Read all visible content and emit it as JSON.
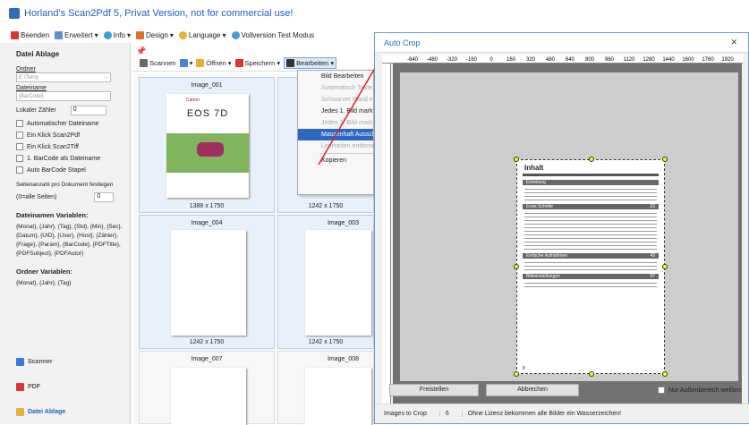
{
  "app": {
    "title": "Horland's Scan2Pdf 5, Privat Version, not for commercial use!"
  },
  "menu": [
    {
      "label": "Beenden",
      "icon": "close-icon"
    },
    {
      "label": "Erweitert",
      "icon": "gear-icon"
    },
    {
      "label": "Info",
      "icon": "info-icon"
    },
    {
      "label": "Design",
      "icon": "palette-icon"
    },
    {
      "label": "Language",
      "icon": "globe-icon"
    },
    {
      "label": "Vollversion Test Modus",
      "icon": "refresh-icon"
    }
  ],
  "sidebar": {
    "header": "Datei Ablage",
    "ordner_label": "Ordner",
    "ordner_value": "E:\\Temp",
    "dateiname_label": "Dateiname",
    "dateiname_value": "{BarCode}",
    "zaehler_label": "Lokaler Zähler",
    "zaehler_value": "0",
    "checks": [
      "Automatischer Dateiname",
      "Ein Klick Scan2Pdf",
      "Ein Klick Scan2Tiff",
      "1. BarCode als Dateiname",
      "Auto BarCode Stapel"
    ],
    "seiten_label": "Seitenanzahl pro Dokument festlegen",
    "alle_label": "(0=alle Seiten)",
    "alle_value": "0",
    "vars_title": "Dateinamen Variablen:",
    "vars_text": "{Monat}, {Jahr}, {Tag}, {Std}, {Min}, {Sec}, {Datum}, {UID}, {User}, {Host}, {Zähler}, {Frage}, {Param}, {BarCode}, {PDFTitle}, {PDFSubject}, {PDFAutor}",
    "ordner_vars_title": "Ordner Variablen:",
    "ordner_vars_text": "{Monat}, {Jahr}, {Tag}",
    "nav": [
      "Scanner",
      "PDF",
      "Datei Ablage"
    ]
  },
  "toolbar": {
    "scannen": "Scannen",
    "oeffnen": "Öffnen",
    "speichern": "Speichern",
    "bearbeiten": "Bearbeiten"
  },
  "thumbs": [
    {
      "name": "Image_001",
      "size": "1388 x 1750"
    },
    {
      "name": "Image_004",
      "size": "1242 x 1750"
    },
    {
      "name": "Image_003",
      "size": "1242 x 1750"
    },
    {
      "name": "Image_007",
      "size": ""
    },
    {
      "name": "Image_008",
      "size": ""
    },
    {
      "name": "",
      "size": "1242 x 1750"
    }
  ],
  "canon": {
    "brand": "Canon",
    "model": "EOS 7D"
  },
  "context_menu": [
    {
      "label": "Bild Bearbeiten",
      "state": "normal"
    },
    {
      "label": "Automatisch Texte...",
      "state": "disabled"
    },
    {
      "label": "Schwarzer Rand en...",
      "state": "disabled"
    },
    {
      "label": "Jedes 1. Bild markie...",
      "state": "normal"
    },
    {
      "label": "Jedes 2. Bild markie...",
      "state": "disabled"
    },
    {
      "label": "Massenhaft Ausschn...",
      "state": "selected"
    },
    {
      "label": "Leerseiten entferne...",
      "state": "disabled"
    },
    {
      "label": "Kopieren",
      "state": "normal"
    }
  ],
  "dialog": {
    "title": "Auto Crop",
    "ruler": [
      "-640",
      "-480",
      "-320",
      "-160",
      "0",
      "160",
      "320",
      "480",
      "640",
      "800",
      "960",
      "1120",
      "1280",
      "1440",
      "1600",
      "1760",
      "1920"
    ],
    "freistellen": "Freistellen",
    "abbrechen": "Abbrechen",
    "checkbox": "Nur Außenbereich weißen",
    "images_label": "Images to Crop",
    "images_count": "6",
    "license_note": "Ohne Lizenz bekommen alle Bilder ein Wasserzeichen!",
    "doc_title": "Inhalt",
    "sections": [
      "Einleitung",
      "Erste Schritte",
      "Einfache Aufnahmen",
      "Bildeinstellungen"
    ],
    "section_pages": [
      "",
      "23",
      "49",
      "57"
    ],
    "page_number": "8"
  }
}
